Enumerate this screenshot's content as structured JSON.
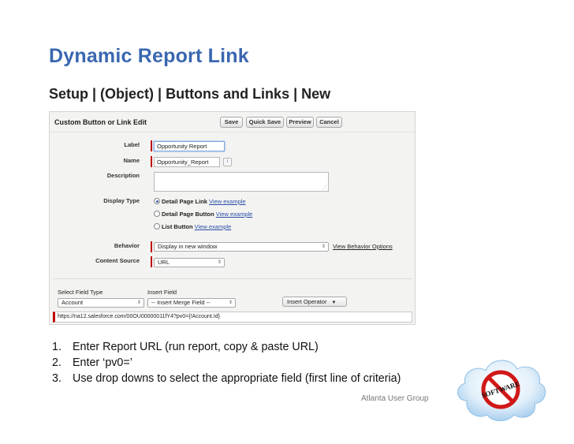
{
  "slide": {
    "title": "Dynamic Report Link",
    "subtitle": "Setup | (Object) | Buttons and Links | New",
    "footer": "Atlanta User Group"
  },
  "panel": {
    "header_title": "Custom Button or Link Edit",
    "buttons": {
      "save": "Save",
      "quick_save": "Quick Save",
      "preview": "Preview",
      "cancel": "Cancel"
    },
    "label_label": "Label",
    "label_value": "Opportunity Report",
    "name_label": "Name",
    "name_value": "Opportunity_Report",
    "name_info": "i",
    "description_label": "Description",
    "display_type_label": "Display Type",
    "display_options": [
      {
        "label": "Detail Page Link",
        "link": "View example",
        "checked": true
      },
      {
        "label": "Detail Page Button",
        "link": "View example",
        "checked": false
      },
      {
        "label": "List Button",
        "link": "View example",
        "checked": false
      }
    ],
    "behavior_label": "Behavior",
    "behavior_value": "Display in new window",
    "behavior_link": "View Behavior Options",
    "content_source_label": "Content Source",
    "content_source_value": "URL",
    "select_field_type_label": "Select Field Type",
    "select_field_type_value": "Account",
    "insert_field_label": "Insert Field",
    "insert_field_value": "-- Insert Merge Field --",
    "insert_operator_label": "Insert Operator",
    "url_value": "https://na12.salesforce.com/00OU00000011fY4?pv0={!Account.Id}",
    "select_arrows": "⇕",
    "operator_arrow": "▼",
    "resize_grip": "⋰"
  },
  "steps": [
    {
      "num": "1.",
      "text": "Enter Report URL (run report, copy & paste URL)"
    },
    {
      "num": "2.",
      "text": "Enter ‘pv0=’"
    },
    {
      "num": "3.",
      "text": "Use drop downs to select the appropriate field (first line of criteria)"
    }
  ],
  "logo": {
    "text": "SOFTWARE",
    "icon": "no-software-cloud-logo"
  }
}
